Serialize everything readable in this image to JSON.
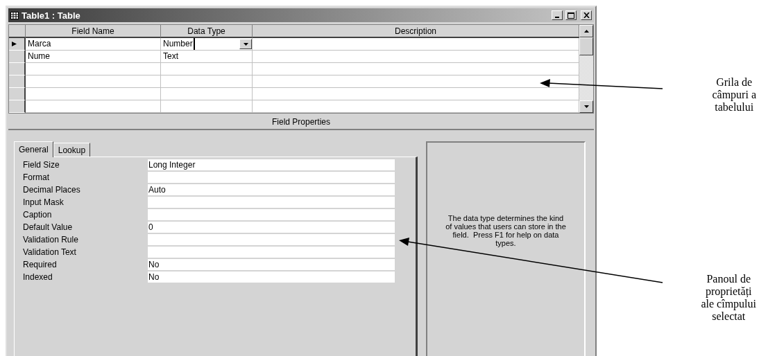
{
  "window": {
    "title": "Table1 : Table"
  },
  "grid": {
    "columns": [
      "Field Name",
      "Data Type",
      "Description"
    ],
    "rows": [
      {
        "field_name": "Marca",
        "data_type": "Number",
        "current": true
      },
      {
        "field_name": "Nume",
        "data_type": "Text",
        "current": false
      },
      {
        "current": false
      },
      {
        "current": false
      },
      {
        "current": false
      },
      {
        "current": false
      }
    ]
  },
  "field_properties": {
    "title": "Field Properties",
    "tabs": [
      {
        "label": "General",
        "selected": true
      },
      {
        "label": "Lookup",
        "selected": false
      }
    ],
    "properties": [
      {
        "label": "Field Size",
        "value": "Long Integer"
      },
      {
        "label": "Format"
      },
      {
        "label": "Decimal Places",
        "value": "Auto"
      },
      {
        "label": "Input Mask"
      },
      {
        "label": "Caption"
      },
      {
        "label": "Default Value",
        "value": "0"
      },
      {
        "label": "Validation Rule"
      },
      {
        "label": "Validation Text"
      },
      {
        "label": "Required",
        "value": "No"
      },
      {
        "label": "Indexed",
        "value": "No"
      }
    ],
    "help_text": "The data type determines the kind of values that users can store in the field.  Press F1 for help on data types."
  },
  "annotations": [
    {
      "lines": [
        "Grila de",
        "câmpuri a",
        "tabelului"
      ]
    },
    {
      "lines": [
        "Panoul de",
        "proprietăți",
        "ale cîmpului",
        "selectat"
      ]
    }
  ]
}
